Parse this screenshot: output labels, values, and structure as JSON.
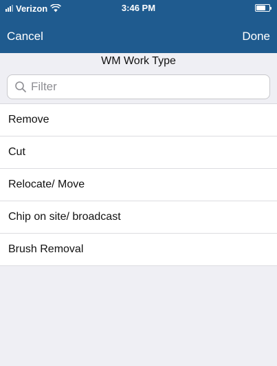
{
  "status_bar": {
    "carrier": "Verizon",
    "time": "3:46 PM",
    "battery_level": 0.7
  },
  "nav": {
    "cancel_label": "Cancel",
    "done_label": "Done"
  },
  "header": {
    "title": "WM Work Type"
  },
  "search": {
    "placeholder": "Filter",
    "value": ""
  },
  "list": {
    "items": [
      {
        "label": "Remove"
      },
      {
        "label": "Cut"
      },
      {
        "label": "Relocate/ Move"
      },
      {
        "label": "Chip on site/ broadcast"
      },
      {
        "label": "Brush Removal"
      }
    ]
  },
  "colors": {
    "nav_background": "#1f5b8f",
    "page_background": "#efeff4"
  },
  "icons": {
    "signal": "signal-icon",
    "wifi": "wifi-icon",
    "battery": "battery-icon",
    "search": "search-icon"
  }
}
